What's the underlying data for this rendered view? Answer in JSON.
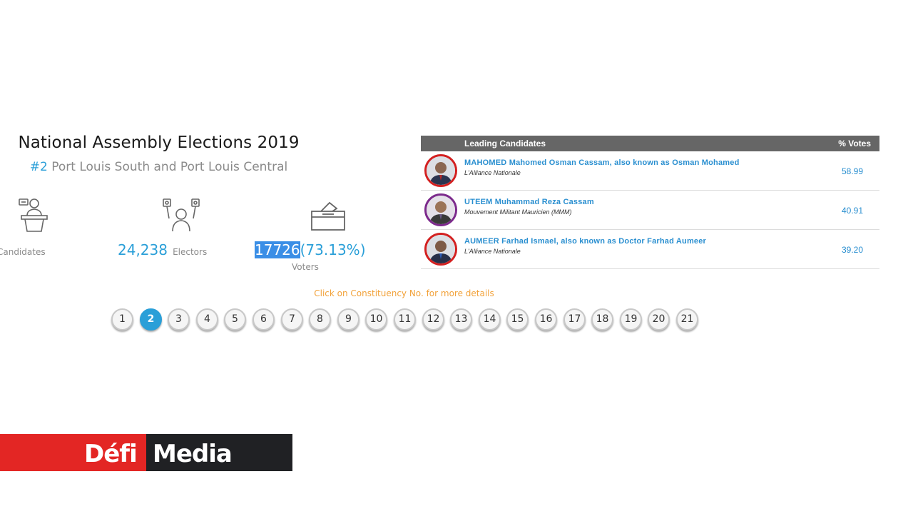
{
  "header": {
    "title": "National Assembly Elections 2019",
    "constituency_number": "#2",
    "constituency_name": "Port Louis South and Port Louis Central"
  },
  "stats": {
    "candidates_label": "Candidates",
    "electors_value": "24,238",
    "electors_label": "Electors",
    "voters_value": "17726",
    "voters_percent": "(73.13%)",
    "voters_label": "Voters",
    "icons": [
      "candidate-podium-icon",
      "electors-crowd-icon",
      "ballot-box-icon"
    ]
  },
  "table": {
    "header_candidates": "Leading Candidates",
    "header_votes": "% Votes",
    "rows": [
      {
        "name": "MAHOMED Mahomed Osman Cassam, also known as Osman Mohamed",
        "party": "L'Alliance Nationale",
        "votes": "58.99",
        "border_color": "#d32020"
      },
      {
        "name": "UTEEM Muhammad Reza Cassam",
        "party": "Mouvement Militant Mauricien (MMM)",
        "votes": "40.91",
        "border_color": "#7c2a8c"
      },
      {
        "name": "AUMEER Farhad Ismael, also known as Doctor Farhad Aumeer",
        "party": "L'Alliance Nationale",
        "votes": "39.20",
        "border_color": "#d32020"
      }
    ]
  },
  "pager": {
    "hint": "Click on Constituency No. for more details",
    "pages": [
      "1",
      "2",
      "3",
      "4",
      "5",
      "6",
      "7",
      "8",
      "9",
      "10",
      "11",
      "12",
      "13",
      "14",
      "15",
      "16",
      "17",
      "18",
      "19",
      "20",
      "21"
    ],
    "active": "2"
  },
  "logo": {
    "word1": "Défi",
    "word2": "Media",
    "colors": {
      "red": "#e32624",
      "dark": "#202124"
    }
  },
  "colors": {
    "accent_blue": "#2a9fd8",
    "hint_orange": "#f2a23a",
    "table_header": "#666666"
  }
}
